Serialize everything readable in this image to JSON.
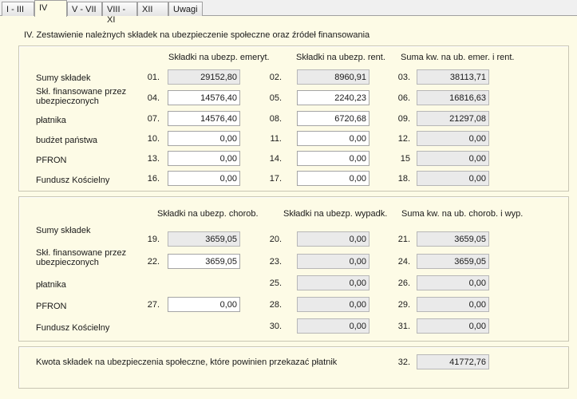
{
  "tabs": [
    "I - III",
    "IV",
    "V - VII",
    "VIII - XI",
    "XII",
    "Uwagi"
  ],
  "page_title": "IV. Zestawienie należnych składek na ubezpieczenie społeczne oraz źródeł finansowania",
  "section1": {
    "headers": [
      "Składki na ubezp. emeryt.",
      "Składki na ubezp. rent.",
      "Suma kw. na ub. emer. i rent."
    ],
    "labels": [
      "Sumy składek",
      "Skł. finansowane przez",
      "ubezpieczonych",
      "płatnika",
      "budżet państwa",
      "PFRON",
      "Fundusz Kościelny"
    ],
    "rows": [
      {
        "cells": [
          {
            "num": "01.",
            "value": "29152,80"
          },
          {
            "num": "02.",
            "value": "8960,91"
          },
          {
            "num": "03.",
            "value": "38113,71"
          }
        ]
      },
      {
        "cells": [
          {
            "num": "04.",
            "value": "14576,40"
          },
          {
            "num": "05.",
            "value": "2240,23"
          },
          {
            "num": "06.",
            "value": "16816,63"
          }
        ]
      },
      {
        "cells": [
          {
            "num": "07.",
            "value": "14576,40"
          },
          {
            "num": "08.",
            "value": "6720,68"
          },
          {
            "num": "09.",
            "value": "21297,08"
          }
        ]
      },
      {
        "cells": [
          {
            "num": "10.",
            "value": "0,00"
          },
          {
            "num": "11.",
            "value": "0,00"
          },
          {
            "num": "12.",
            "value": "0,00"
          }
        ]
      },
      {
        "cells": [
          {
            "num": "13.",
            "value": "0,00"
          },
          {
            "num": "14.",
            "value": "0,00"
          },
          {
            "num": "15",
            "value": "0,00"
          }
        ]
      },
      {
        "cells": [
          {
            "num": "16.",
            "value": "0,00"
          },
          {
            "num": "17.",
            "value": "0,00"
          },
          {
            "num": "18.",
            "value": "0,00"
          }
        ]
      }
    ]
  },
  "section2": {
    "headers": [
      "Składki na ubezp. chorob.",
      "Składki na ubezp. wypadk.",
      "Suma kw. na ub. chorob. i wyp."
    ],
    "labels": [
      "Sumy składek",
      "Skł. finansowane przez",
      "ubezpieczonych",
      "płatnika",
      "PFRON",
      "Fundusz Kościelny"
    ],
    "rows": [
      {
        "cells": [
          {
            "num": "19.",
            "value": "3659,05"
          },
          {
            "num": "20.",
            "value": "0,00"
          },
          {
            "num": "21.",
            "value": "3659,05"
          }
        ]
      },
      {
        "cells": [
          {
            "num": "22.",
            "value": "3659,05"
          },
          {
            "num": "23.",
            "value": "0,00"
          },
          {
            "num": "24.",
            "value": "3659,05"
          }
        ]
      },
      {
        "cells": [
          null,
          {
            "num": "25.",
            "value": "0,00"
          },
          {
            "num": "26.",
            "value": "0,00"
          }
        ]
      },
      {
        "cells": [
          {
            "num": "27.",
            "value": "0,00"
          },
          {
            "num": "28.",
            "value": "0,00"
          },
          {
            "num": "29.",
            "value": "0,00"
          }
        ]
      },
      {
        "cells": [
          null,
          {
            "num": "30.",
            "value": "0,00"
          },
          {
            "num": "31.",
            "value": "0,00"
          }
        ]
      }
    ]
  },
  "section3": {
    "label": "Kwota składek na ubezpieczenia społeczne, które powinien przekazać płatnik",
    "num": "32.",
    "value": "41772,76"
  }
}
